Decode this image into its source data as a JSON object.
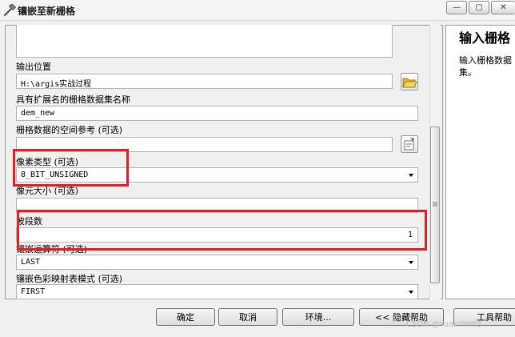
{
  "window": {
    "title": "镶嵌至新栅格",
    "min_glyph": "—",
    "max_glyph": "▢",
    "close_glyph": "✕"
  },
  "form": {
    "output_location": {
      "label": "输出位置",
      "value": "H:\\argis实战过程"
    },
    "dataset_name": {
      "label": "具有扩展名的栅格数据集名称",
      "value": "dem_new"
    },
    "spatial_reference": {
      "label": "栅格数据的空间参考 (可选)",
      "value": ""
    },
    "pixel_type": {
      "label": "像素类型 (可选)",
      "value": "8_BIT_UNSIGNED"
    },
    "cell_size": {
      "label": "像元大小 (可选)",
      "value": ""
    },
    "band_count": {
      "label": "波段数",
      "value": "1"
    },
    "mosaic_operator": {
      "label": "镶嵌运算符 (可选)",
      "value": "LAST"
    },
    "colormap_mode": {
      "label": "镶嵌色彩映射表模式 (可选)",
      "value": "FIRST"
    }
  },
  "help": {
    "title": "输入栅格",
    "body": "输入栅格数据集。"
  },
  "buttons": {
    "ok": "确定",
    "cancel": "取消",
    "environments": "环境...",
    "hide_help": "<< 隐藏帮助",
    "tool_help": "工具帮助"
  },
  "watermark": "CSDN @YuanYWRS",
  "colors": {
    "highlight": "#e0202a",
    "panel_bg": "#f0f0f0",
    "field_bg": "#ffffff"
  }
}
